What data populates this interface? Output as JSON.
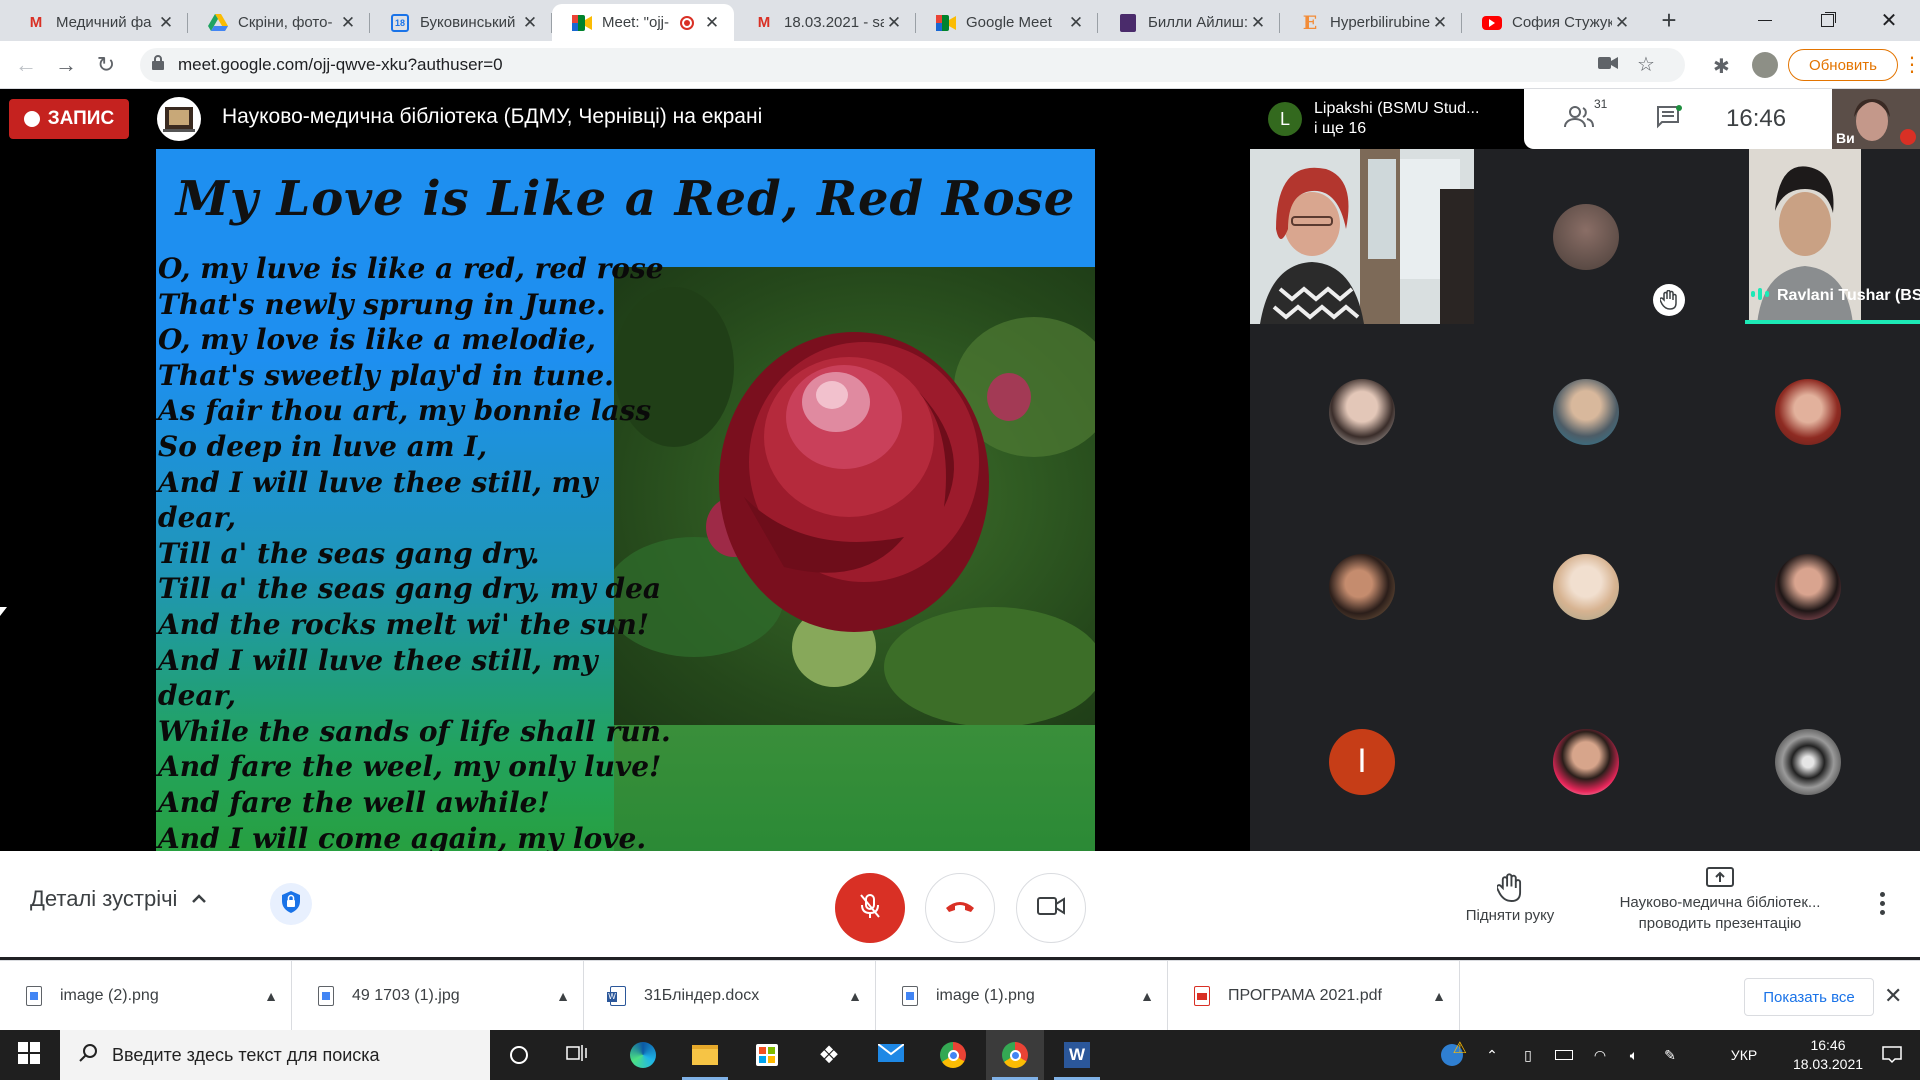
{
  "browser": {
    "tabs": [
      {
        "title": "Медичний фа",
        "icon": "gmail-icon"
      },
      {
        "title": "Скріни, фото-",
        "icon": "google-drive-icon"
      },
      {
        "title": "Буковинський",
        "icon": "calendar-icon"
      },
      {
        "title": "Meet: \"ojj-",
        "icon": "google-meet-icon",
        "active": true,
        "recording": true
      },
      {
        "title": "18.03.2021 - sa",
        "icon": "gmail-icon"
      },
      {
        "title": "Google Meet",
        "icon": "google-meet-icon"
      },
      {
        "title": "Билли Айлиш:",
        "icon": "music-icon"
      },
      {
        "title": "Hyperbilirubine",
        "icon": "e-letter-icon"
      },
      {
        "title": "София Стужук",
        "icon": "youtube-icon"
      }
    ],
    "url": "meet.google.com/ojj-qwve-xku?authuser=0",
    "update_label": "Обновить"
  },
  "meet": {
    "recording_label": "ЗАПИС",
    "presenter_title": "Науково-медична бібліотека (БДМУ, Чернівці) на екрані",
    "active_speaker": {
      "initial": "L",
      "name": "Lipakshi (BSMU Stud...",
      "extra": "і ще 16"
    },
    "participant_count": "31",
    "clock": "16:46",
    "self_label": "Ви",
    "slide": {
      "title": "My Love is Like a Red, Red Rose",
      "lines": [
        "O, my luve is like a red, red rose",
        "That's newly sprung in June.",
        "O, my love is like a melodie,",
        "That's sweetly play'd in tune.",
        "As fair thou art, my bonnie lass",
        "So deep in luve am I,",
        "And I will luve thee still, my",
        "dear,",
        "Till a' the seas gang dry.",
        "Till a' the seas gang dry, my dea",
        "And the rocks melt wi' the sun!",
        "And I will luve thee still, my",
        "dear,",
        "While the sands of life shall run.",
        "And fare the weel, my only luve!",
        "And fare the well awhile!",
        "And I will come again, my love."
      ]
    },
    "named_tile": {
      "name": "Ravlani Tushar (BS..."
    },
    "letter_avatar": "I"
  },
  "controls": {
    "details_label": "Деталі зустрічі",
    "raise_hand_label": "Підняти руку",
    "presenting_line1": "Науково-медична бібліотек...",
    "presenting_line2": "проводить презентацію"
  },
  "downloads": [
    {
      "name": "image (2).png",
      "type": "image"
    },
    {
      "name": "49 1703 (1).jpg",
      "type": "image"
    },
    {
      "name": "31Бліндер.docx",
      "type": "word"
    },
    {
      "name": "image (1).png",
      "type": "image"
    },
    {
      "name": "ПРОГРАМА 2021.pdf",
      "type": "pdf"
    }
  ],
  "show_all_label": "Показать все",
  "taskbar": {
    "search_placeholder": "Введите здесь текст для поиска",
    "language": "УКР",
    "time": "16:46",
    "date": "18.03.2021"
  },
  "colors": {
    "record_red": "#c5221f",
    "mic_off_red": "#d93025",
    "speaking_accent": "#1de9b6",
    "update_orange": "#e37400"
  }
}
